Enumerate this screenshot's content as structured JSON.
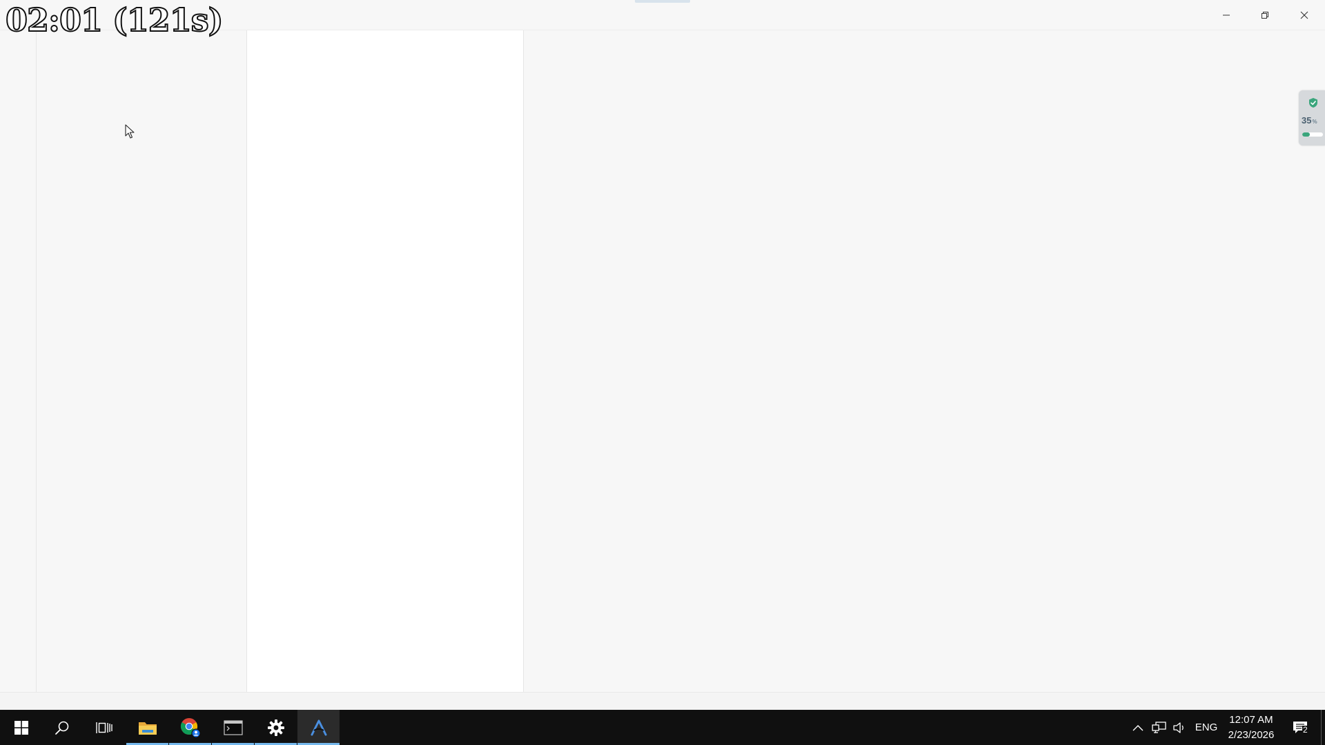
{
  "overlay": {
    "timer_text": "02:01 (121s)"
  },
  "window": {
    "controls": {
      "minimize_icon": "minimize-icon",
      "maximize_icon": "restore-icon",
      "close_icon": "close-icon"
    }
  },
  "side_widget": {
    "icon": "shield-check-icon",
    "percent_value": "35",
    "percent_unit": "%",
    "bar_fraction": 0.35,
    "accent_color": "#3aa57c"
  },
  "taskbar": {
    "apps": [
      {
        "name": "start",
        "icon": "windows-logo-icon"
      },
      {
        "name": "search",
        "icon": "search-icon"
      },
      {
        "name": "task-view",
        "icon": "task-view-icon"
      },
      {
        "name": "file-explorer",
        "icon": "folder-icon",
        "open": true
      },
      {
        "name": "chrome",
        "icon": "chrome-icon",
        "open": true
      },
      {
        "name": "terminal",
        "icon": "terminal-icon",
        "open": true
      },
      {
        "name": "settings",
        "icon": "gear-icon",
        "open": true
      },
      {
        "name": "arc-app",
        "icon": "arc-logo-icon",
        "open": true,
        "active": true
      }
    ],
    "tray": {
      "language": "ENG",
      "time": "12:07 AM",
      "date": "2/23/2026",
      "notification_count": "2"
    },
    "accent_color": "#76b9ed"
  }
}
